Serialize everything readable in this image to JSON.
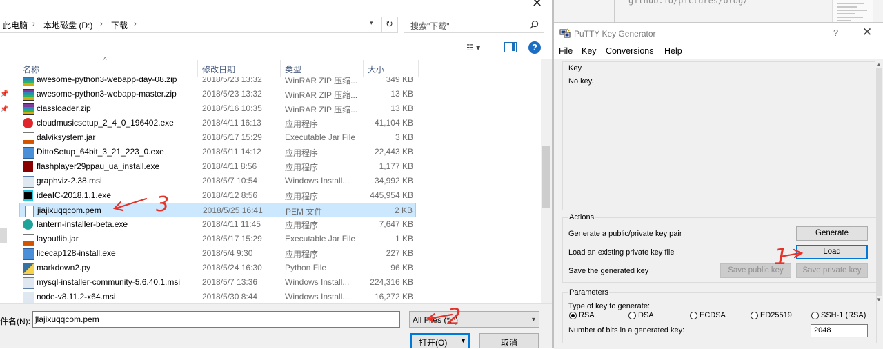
{
  "open_dialog": {
    "breadcrumb": [
      "此电脑",
      "本地磁盘 (D:)",
      "下载"
    ],
    "search_placeholder": "搜索\"下载\"",
    "columns": {
      "name": "名称",
      "date": "修改日期",
      "type": "类型",
      "size": "大小"
    },
    "files": [
      {
        "name": "awesome-python3-webapp-day-08.zip",
        "date": "2018/5/23 13:32",
        "type": "WinRAR ZIP 压缩...",
        "size": "349 KB",
        "icon": "winrar-archive-icon"
      },
      {
        "name": "awesome-python3-webapp-master.zip",
        "date": "2018/5/23 13:32",
        "type": "WinRAR ZIP 压缩...",
        "size": "13 KB",
        "icon": "winrar-archive-icon"
      },
      {
        "name": "classloader.zip",
        "date": "2018/5/16 10:35",
        "type": "WinRAR ZIP 压缩...",
        "size": "13 KB",
        "icon": "winrar-archive-icon"
      },
      {
        "name": "cloudmusicsetup_2_4_0_196402.exe",
        "date": "2018/4/11 16:13",
        "type": "应用程序",
        "size": "41,104 KB",
        "icon": "netease-music-icon"
      },
      {
        "name": "dalviksystem.jar",
        "date": "2018/5/17 15:29",
        "type": "Executable Jar File",
        "size": "3 KB",
        "icon": "jar-file-icon"
      },
      {
        "name": "DittoSetup_64bit_3_21_223_0.exe",
        "date": "2018/5/11 14:12",
        "type": "应用程序",
        "size": "22,443 KB",
        "icon": "installer-icon"
      },
      {
        "name": "flashplayer29ppau_ua_install.exe",
        "date": "2018/4/11 8:56",
        "type": "应用程序",
        "size": "1,177 KB",
        "icon": "flash-player-icon"
      },
      {
        "name": "graphviz-2.38.msi",
        "date": "2018/5/7 10:54",
        "type": "Windows Install...",
        "size": "34,992 KB",
        "icon": "msi-package-icon"
      },
      {
        "name": "ideaIC-2018.1.1.exe",
        "date": "2018/4/12 8:56",
        "type": "应用程序",
        "size": "445,954 KB",
        "icon": "intellij-icon"
      },
      {
        "name": "jiajixuqqcom.pem",
        "date": "2018/5/25 16:41",
        "type": "PEM 文件",
        "size": "2 KB",
        "icon": "blank-file-icon",
        "selected": true
      },
      {
        "name": "lantern-installer-beta.exe",
        "date": "2018/4/11 11:45",
        "type": "应用程序",
        "size": "7,647 KB",
        "icon": "lantern-icon"
      },
      {
        "name": "layoutlib.jar",
        "date": "2018/5/17 15:29",
        "type": "Executable Jar File",
        "size": "1 KB",
        "icon": "jar-file-icon"
      },
      {
        "name": "licecap128-install.exe",
        "date": "2018/5/4 9:30",
        "type": "应用程序",
        "size": "227 KB",
        "icon": "installer-icon"
      },
      {
        "name": "markdown2.py",
        "date": "2018/5/24 16:30",
        "type": "Python File",
        "size": "96 KB",
        "icon": "python-file-icon"
      },
      {
        "name": "mysql-installer-community-5.6.40.1.msi",
        "date": "2018/5/7 13:36",
        "type": "Windows Install...",
        "size": "224,316 KB",
        "icon": "msi-package-icon"
      },
      {
        "name": "node-v8.11.2-x64.msi",
        "date": "2018/5/30 8:44",
        "type": "Windows Install...",
        "size": "16,272 KB",
        "icon": "msi-package-icon"
      }
    ],
    "filename_label": "件名(N):",
    "filename_value": "jiajixuqqcom.pem",
    "filetype_value": "All Files (*.*)",
    "open_label": "打开(O)",
    "cancel_label": "取消"
  },
  "background_editor": {
    "code_text": "github.io/pictures/blog/"
  },
  "puttygen": {
    "title": "PuTTY Key Generator",
    "title_help": "?",
    "menu": [
      "File",
      "Key",
      "Conversions",
      "Help"
    ],
    "key_label": "Key",
    "key_value": "No key.",
    "actions_label": "Actions",
    "gen_text": "Generate a public/private key pair",
    "generate_btn": "Generate",
    "load_text": "Load an existing private key file",
    "load_btn": "Load",
    "save_text": "Save the generated key",
    "save_public_btn": "Save public key",
    "save_private_btn": "Save private key",
    "params_label": "Parameters",
    "type_label": "Type of key to generate:",
    "key_types": [
      "RSA",
      "DSA",
      "ECDSA",
      "ED25519",
      "SSH-1 (RSA)"
    ],
    "selected_key_type": "RSA",
    "bits_label": "Number of bits in a generated key:",
    "bits_value": "2048"
  },
  "annotations": [
    "1",
    "2",
    "3"
  ],
  "colors": {
    "selection": "#cce8ff",
    "accent": "#0078d7",
    "annotation": "#e5332a"
  }
}
